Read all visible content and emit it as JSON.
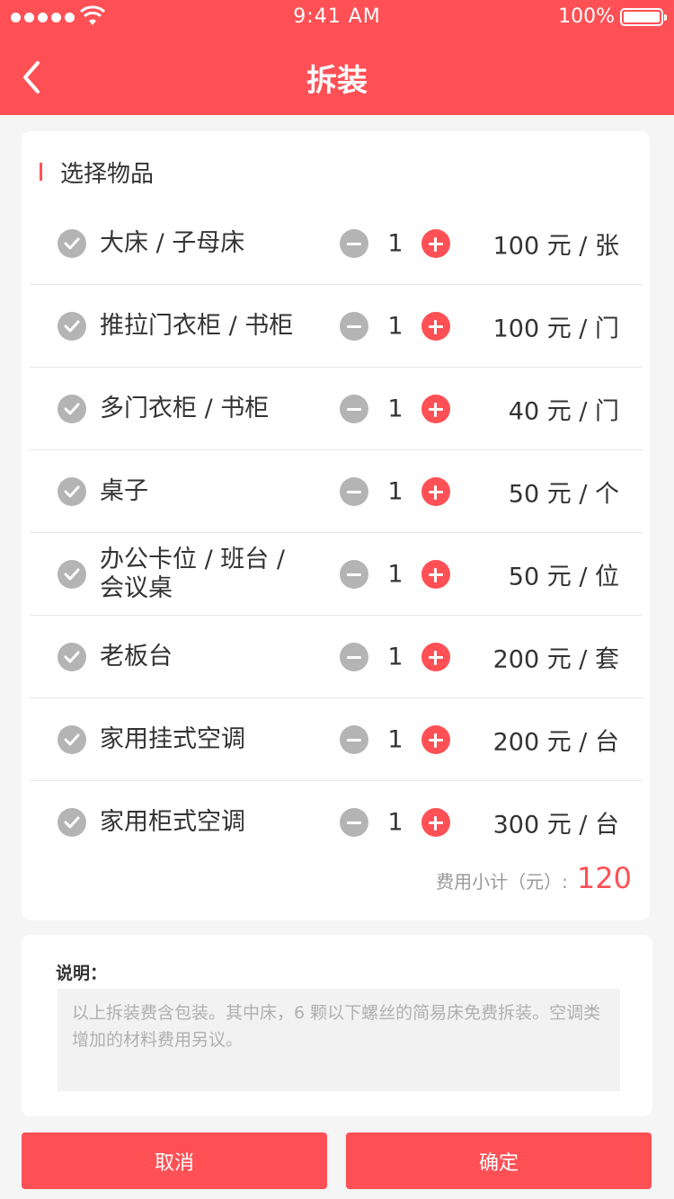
{
  "status_bar": {
    "time": "9:41 AM",
    "battery": "100%"
  },
  "header": {
    "title": "拆装"
  },
  "section": {
    "title": "选择物品"
  },
  "items": [
    {
      "name": "大床 / 子母床",
      "qty": "1",
      "price": "100 元 / 张"
    },
    {
      "name": "推拉门衣柜 / 书柜",
      "qty": "1",
      "price": "100 元 / 门"
    },
    {
      "name": "多门衣柜 / 书柜",
      "qty": "1",
      "price": "40 元 / 门"
    },
    {
      "name": "桌子",
      "qty": "1",
      "price": "50 元 / 个"
    },
    {
      "name": "办公卡位 / 班台 / 会议桌",
      "qty": "1",
      "price": "50 元 / 位"
    },
    {
      "name": "老板台",
      "qty": "1",
      "price": "200 元 / 套"
    },
    {
      "name": "家用挂式空调",
      "qty": "1",
      "price": "200 元 / 台"
    },
    {
      "name": "家用柜式空调",
      "qty": "1",
      "price": "300 元 / 台"
    }
  ],
  "subtotal": {
    "label": "费用小计（元）:",
    "value": "120"
  },
  "note": {
    "label": "说明：",
    "text": "以上拆装费含包装。其中床，6 颗以下螺丝的简易床免费拆装。空调类增加的材料费用另议。"
  },
  "buttons": {
    "cancel": "取消",
    "confirm": "确定"
  },
  "colors": {
    "accent": "#ff5055",
    "check_gray": "#b4b4b4",
    "background": "#f5f5f5"
  }
}
